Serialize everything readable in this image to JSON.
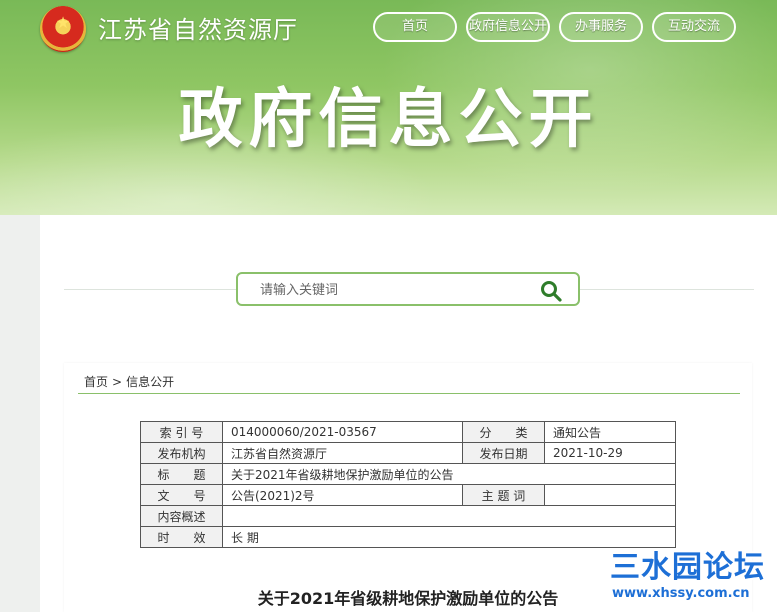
{
  "header": {
    "site_name": "江苏省自然资源厅",
    "emblem": "national-emblem-icon",
    "nav": [
      {
        "label": "首页"
      },
      {
        "label": "政府信息公开"
      },
      {
        "label": "办事服务"
      },
      {
        "label": "互动交流"
      }
    ],
    "hero_title": "政府信息公开"
  },
  "search": {
    "placeholder": "请输入关键词",
    "icon": "search-icon",
    "accent": "#8ac06a"
  },
  "breadcrumb": {
    "home": "首页",
    "separator": ">",
    "current": "信息公开"
  },
  "meta": {
    "index_label": "索 引 号",
    "index_value": "014000060/2021-03567",
    "category_label": "分　　类",
    "category_value": "通知公告",
    "publisher_label": "发布机构",
    "publisher_value": "江苏省自然资源厅",
    "date_label": "发布日期",
    "date_value": "2021-10-29",
    "title_label": "标　　题",
    "title_value": "关于2021年省级耕地保护激励单位的公告",
    "doc_no_label": "文　　号",
    "doc_no_value": "公告(2021)2号",
    "keywords_label": "主 题 词",
    "keywords_value": "",
    "summary_label": "内容概述",
    "summary_value": "",
    "validity_label": "时　　效",
    "validity_value": "长 期"
  },
  "document": {
    "title": "关于2021年省级耕地保护激励单位的公告"
  },
  "watermark": {
    "main": "三水园论坛",
    "sub": "www.xhssy.com.cn",
    "color": "#1d6fd6"
  }
}
